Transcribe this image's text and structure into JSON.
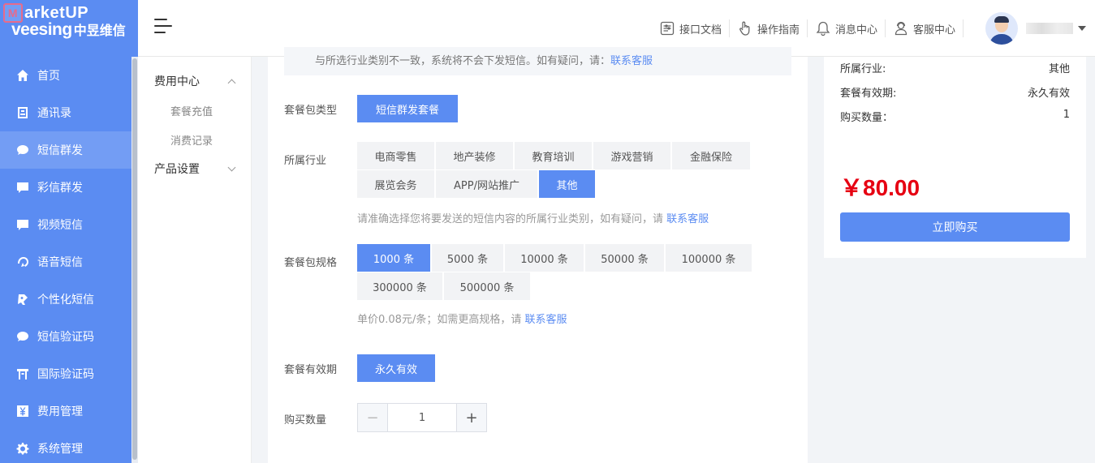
{
  "brand": {
    "logo_top": "arketUP",
    "logo_bottom": "veesing",
    "logo_bottom_cn": "中昱维信"
  },
  "sidebar": {
    "items": [
      {
        "label": "首页",
        "icon": "home-icon"
      },
      {
        "label": "通讯录",
        "icon": "contacts-icon"
      },
      {
        "label": "短信群发",
        "icon": "sms-icon",
        "active": true
      },
      {
        "label": "彩信群发",
        "icon": "mms-icon"
      },
      {
        "label": "视频短信",
        "icon": "video-sms-icon"
      },
      {
        "label": "语音短信",
        "icon": "voice-sms-icon"
      },
      {
        "label": "个性化短信",
        "icon": "personalized-sms-icon"
      },
      {
        "label": "短信验证码",
        "icon": "sms-code-icon"
      },
      {
        "label": "国际验证码",
        "icon": "intl-code-icon"
      },
      {
        "label": "费用管理",
        "icon": "yen-icon"
      },
      {
        "label": "系统管理",
        "icon": "gear-icon"
      }
    ]
  },
  "header": {
    "links": [
      {
        "label": "接口文档",
        "icon": "api-doc-icon"
      },
      {
        "label": "操作指南",
        "icon": "hand-pointer-icon"
      },
      {
        "label": "消息中心",
        "icon": "bell-icon"
      },
      {
        "label": "客服中心",
        "icon": "support-icon"
      }
    ]
  },
  "submenu": {
    "group1": "费用中心",
    "group1_items": [
      "套餐充值",
      "消费记录"
    ],
    "group2": "产品设置"
  },
  "main": {
    "notice_text": "与所选行业类别不一致，系统将不会下发短信。如有疑问，请：",
    "notice_link": "联系客服",
    "package_type_label": "套餐包类型",
    "package_type": "短信群发套餐",
    "industry_label": "所属行业",
    "industries": [
      "电商零售",
      "地产装修",
      "教育培训",
      "游戏营销",
      "金融保险",
      "展览会务",
      "APP/网站推广",
      "其他"
    ],
    "industry_selected": "其他",
    "industry_hint": "请准确选择您将要发送的短信内容的所属行业类别，如有疑问，请",
    "industry_hint_link": "联系客服",
    "spec_label": "套餐包规格",
    "specs": [
      "1000 条",
      "5000 条",
      "10000 条",
      "50000 条",
      "100000 条",
      "300000 条",
      "500000 条"
    ],
    "spec_selected": "1000 条",
    "spec_hint": "单价0.08元/条；如需更高规格，请",
    "spec_hint_link": "联系客服",
    "validity_label": "套餐有效期",
    "validity": "永久有效",
    "qty_label": "购买数量",
    "qty": "1",
    "minus": "−",
    "plus": "+"
  },
  "summary": {
    "industry_label": "所属行业:",
    "industry_value": "其他",
    "validity_label": "套餐有效期:",
    "validity_value": "永久有效",
    "qty_label": "购买数量：",
    "qty_value": "1",
    "price": "￥80.00",
    "buy_label": "立即购买"
  },
  "colors": {
    "primary": "#5b8cf2",
    "price": "#e60012"
  }
}
